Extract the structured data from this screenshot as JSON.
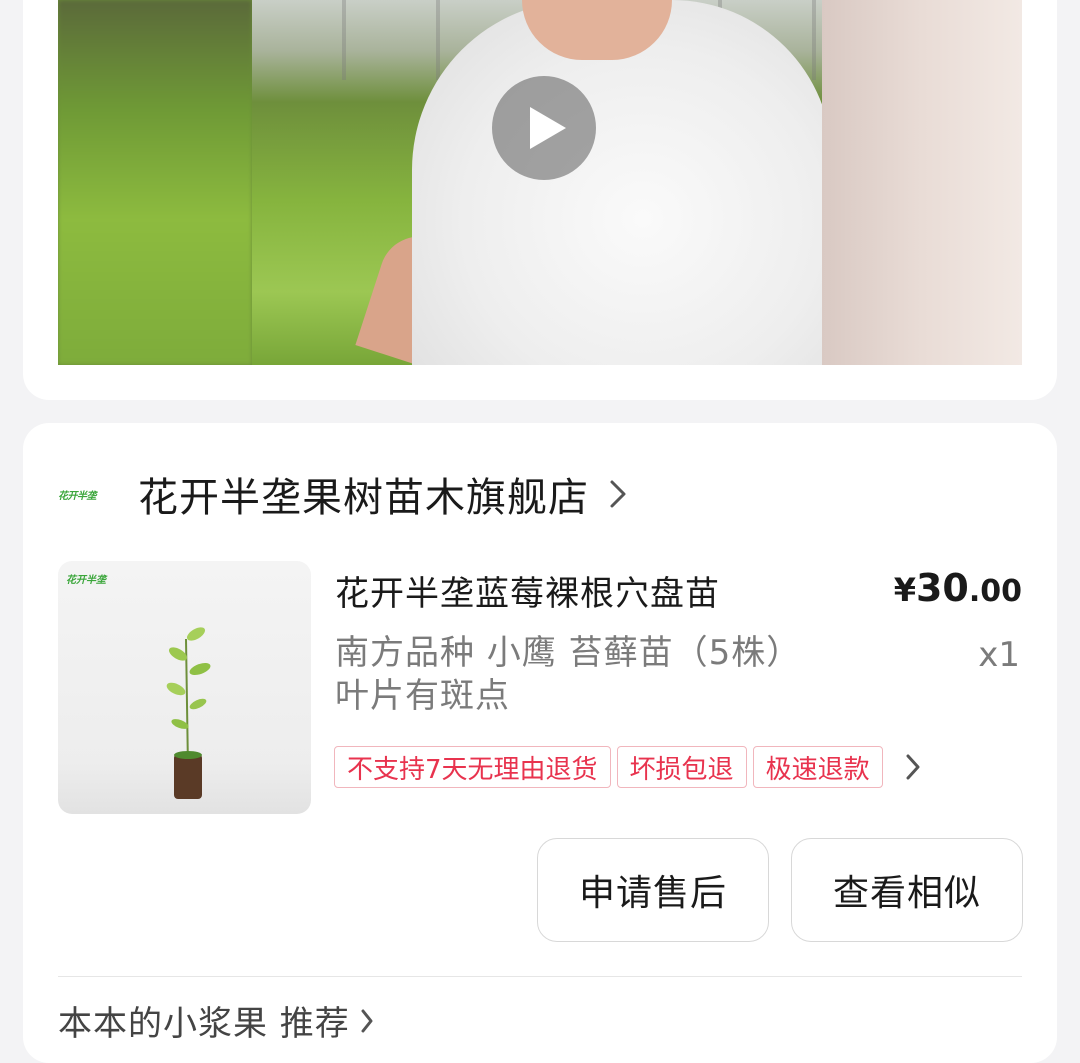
{
  "video": {
    "play_icon": "play-icon"
  },
  "shop": {
    "logo_text": "花开半垄",
    "name": "花开半垄果树苗木旗舰店",
    "chevron_icon": "chevron-right-icon"
  },
  "product": {
    "image_brand": "花开半垄",
    "title": "花开半垄蓝莓裸根穴盘苗",
    "price_symbol": "¥",
    "price_integer": "30",
    "price_decimal": ".00",
    "spec_line1": "南方品种 小鹰 苔藓苗（5株）",
    "spec_line2": "叶片有斑点",
    "quantity": "x1",
    "tags": [
      "不支持7天无理由退货",
      "坏损包退",
      "极速退款"
    ]
  },
  "actions": {
    "after_sale": "申请售后",
    "view_similar": "查看相似"
  },
  "recommend": {
    "label": "本本的小浆果 推荐"
  },
  "colors": {
    "tag_red": "#e8334e",
    "tag_border": "#f1b6bd",
    "page_bg": "#f3f3f5"
  }
}
